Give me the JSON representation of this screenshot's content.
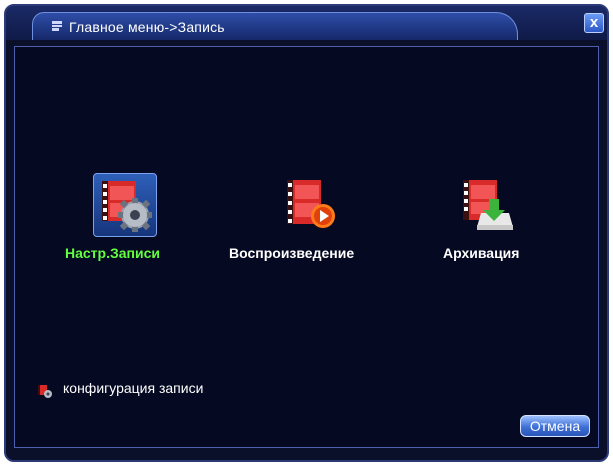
{
  "window": {
    "title": "Главное меню->Запись",
    "close_label": "x"
  },
  "tiles": [
    {
      "label": "Настр.Записи",
      "icon": "record-settings-icon",
      "selected": true
    },
    {
      "label": "Воспроизведение",
      "icon": "playback-icon",
      "selected": false
    },
    {
      "label": "Архивация",
      "icon": "backup-icon",
      "selected": false
    }
  ],
  "hint": {
    "text": "конфигурация записи",
    "icon": "record-config-icon"
  },
  "buttons": {
    "cancel_label": "Отмена"
  },
  "colors": {
    "background": "#050a22",
    "selected_label": "#62ff3e",
    "film_red": "#d92a2a",
    "accent_blue": "#3d6fd6"
  }
}
